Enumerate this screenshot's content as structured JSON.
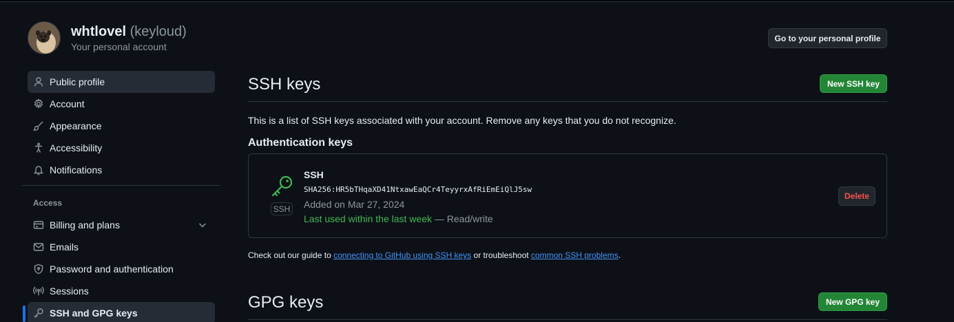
{
  "account": {
    "name": "whtlovel",
    "handle": "(keyloud)",
    "subtitle": "Your personal account",
    "profile_button": "Go to your personal profile"
  },
  "sidebar": {
    "items": [
      {
        "label": "Public profile",
        "icon": "person-icon"
      },
      {
        "label": "Account",
        "icon": "gear-icon"
      },
      {
        "label": "Appearance",
        "icon": "paintbrush-icon"
      },
      {
        "label": "Accessibility",
        "icon": "accessibility-icon"
      },
      {
        "label": "Notifications",
        "icon": "bell-icon"
      }
    ],
    "group_label": "Access",
    "access_items": [
      {
        "label": "Billing and plans",
        "icon": "credit-card-icon"
      },
      {
        "label": "Emails",
        "icon": "mail-icon"
      },
      {
        "label": "Password and authentication",
        "icon": "shield-lock-icon"
      },
      {
        "label": "Sessions",
        "icon": "broadcast-icon"
      },
      {
        "label": "SSH and GPG keys",
        "icon": "key-icon"
      }
    ]
  },
  "ssh": {
    "title": "SSH keys",
    "new_button": "New SSH key",
    "description": "This is a list of SSH keys associated with your account. Remove any keys that you do not recognize.",
    "auth_heading": "Authentication keys",
    "key": {
      "badge": "SSH",
      "title": "SSH",
      "fingerprint": "SHA256:HR5bTHqaXD41NtxawEaQCr4TeyyrxAfRiEmEiQlJ5sw",
      "added": "Added on Mar 27, 2024",
      "last_used": "Last used within the last week",
      "access": "— Read/write",
      "delete_button": "Delete"
    },
    "guide": {
      "prefix": "Check out our guide to ",
      "link1": "connecting to GitHub using SSH keys",
      "middle": " or troubleshoot ",
      "link2": "common SSH problems",
      "suffix": "."
    }
  },
  "gpg": {
    "title": "GPG keys",
    "new_button": "New GPG key"
  },
  "colors": {
    "background": "#0d1117",
    "accent_green": "#238636",
    "danger": "#f85149",
    "link": "#4493f8",
    "selected_bar": "#1f6feb"
  }
}
